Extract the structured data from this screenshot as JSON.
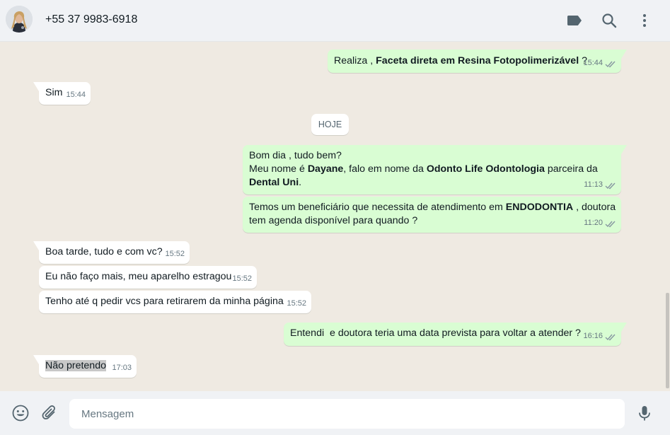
{
  "header": {
    "contact_name": "+55 37 9983-6918",
    "icons": [
      "label-icon",
      "search-icon",
      "menu-icon"
    ]
  },
  "chat": {
    "day_separator": "HOJE",
    "messages": [
      {
        "direction": "out",
        "parts": [
          {
            "text": "Realiza , "
          },
          {
            "text": "Faceta direta em Resina Fotopolimerizável",
            "bold": true
          },
          {
            "text": " ?"
          }
        ],
        "time": "15:44",
        "status": "read"
      },
      {
        "direction": "in",
        "text": "Sim",
        "time": "15:44"
      },
      {
        "direction": "out",
        "lines": [
          [
            {
              "text": "Bom dia , tudo bem?"
            }
          ],
          [
            {
              "text": "Meu nome é "
            },
            {
              "text": "Dayane",
              "bold": true
            },
            {
              "text": ", falo em nome da "
            },
            {
              "text": "Odonto Life Odontologia",
              "bold": true
            },
            {
              "text": " parceira da"
            }
          ],
          [
            {
              "text": "Dental Uni",
              "bold": true
            },
            {
              "text": "."
            }
          ]
        ],
        "time": "11:13",
        "status": "read"
      },
      {
        "direction": "out",
        "lines": [
          [
            {
              "text": "Temos um beneficiário que necessita de atendimento em "
            },
            {
              "text": "ENDODONTIA",
              "bold": true
            },
            {
              "text": " , doutora"
            }
          ],
          [
            {
              "text": "tem agenda disponível para quando ?"
            }
          ]
        ],
        "time": "11:20",
        "status": "read"
      },
      {
        "direction": "in",
        "text": "Boa tarde, tudo e com vc?",
        "time": "15:52"
      },
      {
        "direction": "in",
        "text": "Eu não faço mais, meu aparelho estragou",
        "time": "15:52"
      },
      {
        "direction": "in",
        "text": "Tenho até q pedir vcs para retirarem da minha página",
        "time": "15:52"
      },
      {
        "direction": "out",
        "text": "Entendi  e doutora teria uma data prevista para voltar a atender ?",
        "time": "16:16",
        "status": "read"
      },
      {
        "direction": "in",
        "text": "Não pretendo",
        "time": "17:03",
        "selected": true
      }
    ]
  },
  "footer": {
    "placeholder": "Mensagem",
    "value": "",
    "icons": [
      "emoji-icon",
      "attach-icon",
      "microphone-icon"
    ]
  },
  "colors": {
    "incoming_bubble": "#ffffff",
    "outgoing_bubble": "#d9fdd3",
    "chat_background": "#efeae2",
    "header_background": "#f0f2f5",
    "meta_text": "#667781",
    "read_tick": "#8696a0"
  }
}
